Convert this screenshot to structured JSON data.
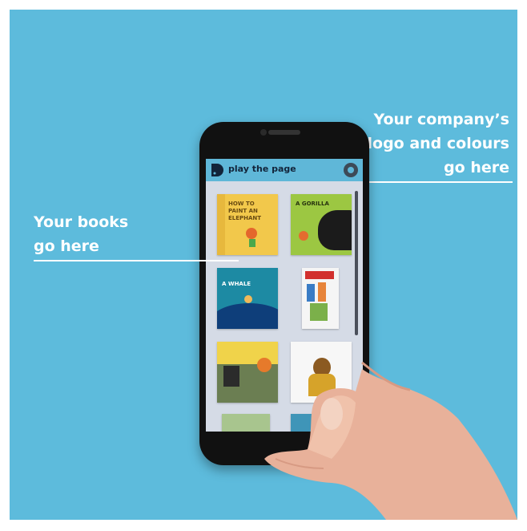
{
  "callouts": {
    "company": {
      "line1": "Your company’s",
      "line2": "logo and colours",
      "line3": "go here"
    },
    "books": {
      "line1": "Your books",
      "line2": "go here"
    }
  },
  "app": {
    "name": "play the page",
    "accent": "#5fb7d8",
    "logo_icon": "play-the-page-logo-icon",
    "settings_icon": "settings-icon"
  },
  "books": [
    {
      "title": "HOW TO PAINT AN ELEPHANT",
      "color": "#f2c84b"
    },
    {
      "title": "A GORILLA",
      "color": "#9cc742"
    },
    {
      "title": "A WHALE",
      "color": "#1d8aa3"
    },
    {
      "title": "",
      "color": "#f5f5f5"
    },
    {
      "title": "",
      "color": "#f0d34a"
    },
    {
      "title": "",
      "color": "#f7f7f7"
    }
  ],
  "colors": {
    "background": "#5dbbdc",
    "text": "#ffffff"
  }
}
